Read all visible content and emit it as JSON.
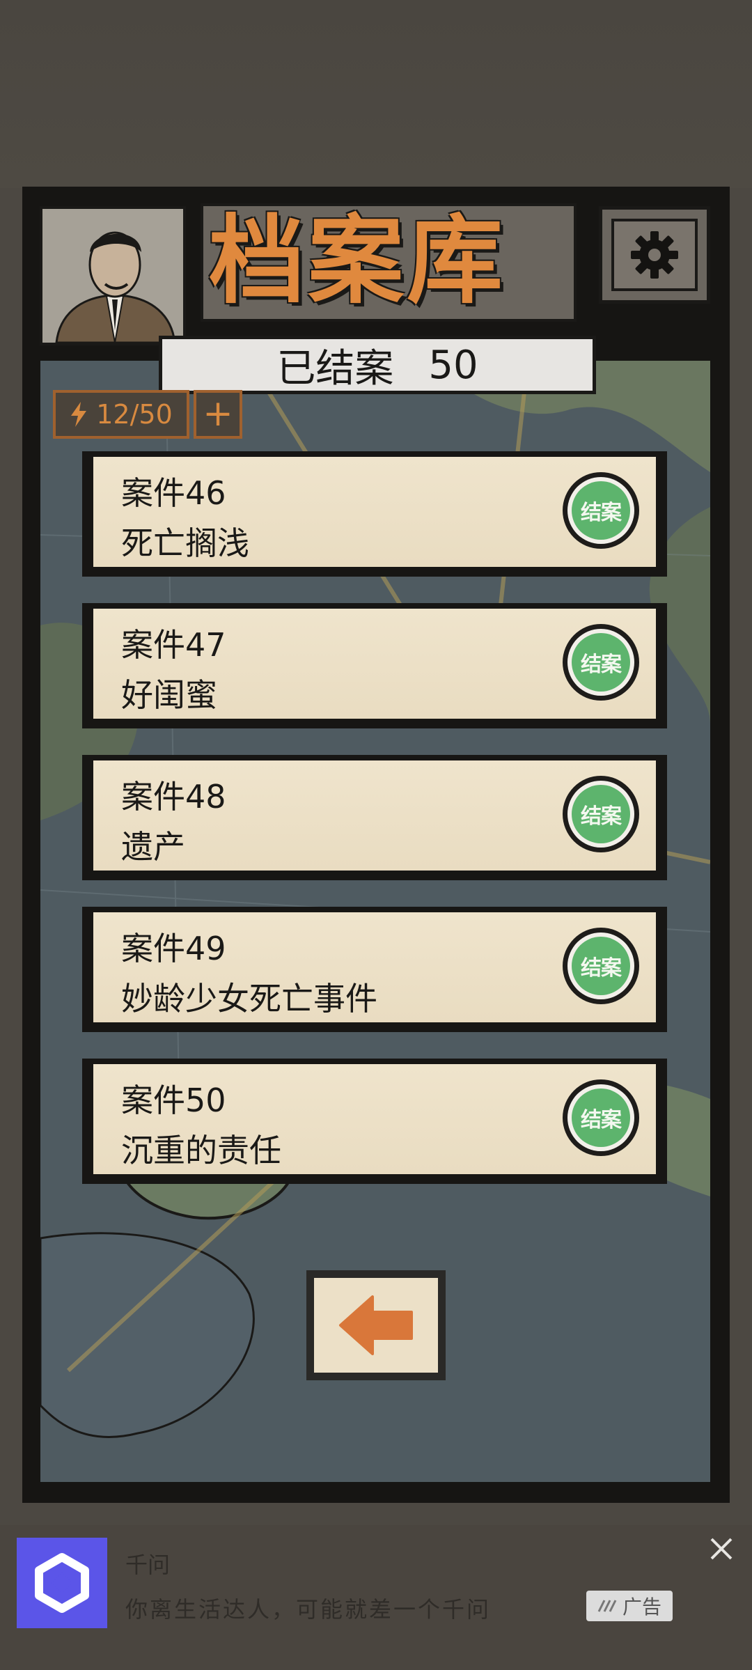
{
  "header": {
    "title": "档案库",
    "closed_label": "已结案",
    "closed_count": "50"
  },
  "energy": {
    "value": "12/50",
    "plus_label": "+"
  },
  "cases": [
    {
      "id": "案件46",
      "name": "死亡搁浅",
      "stamp": "结案"
    },
    {
      "id": "案件47",
      "name": "好闺蜜",
      "stamp": "结案"
    },
    {
      "id": "案件48",
      "name": "遗产",
      "stamp": "结案"
    },
    {
      "id": "案件49",
      "name": "妙龄少女死亡事件",
      "stamp": "结案"
    },
    {
      "id": "案件50",
      "name": "沉重的责任",
      "stamp": "结案"
    }
  ],
  "ad": {
    "title": "千问",
    "text": "你离生活达人，可能就差一个千问",
    "badge": "广告"
  },
  "colors": {
    "title_orange": "#e0893e",
    "stamp_green": "#5db46d",
    "card_paper": "#ece0c7",
    "back_arrow": "#d9773a",
    "ad_logo": "#5b55e8"
  },
  "icons": {
    "settings": "gear-icon",
    "energy": "lightning-icon",
    "back": "arrow-left-icon",
    "close": "close-icon"
  }
}
